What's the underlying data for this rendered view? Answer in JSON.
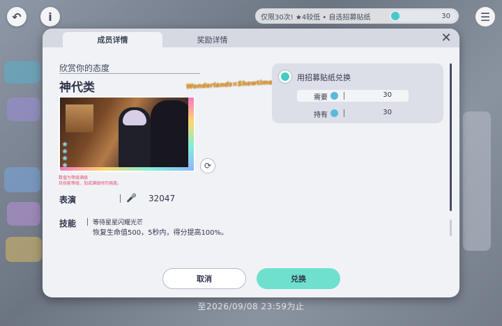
{
  "top": {
    "banner_text": "仅限30次! ★4较低 • 自选招募贴纸",
    "banner_count": "30"
  },
  "tabs": [
    {
      "label": "成员详情"
    },
    {
      "label": "奖励详情"
    }
  ],
  "member": {
    "subtitle": "欣赏你的态度",
    "name": "神代类",
    "unit_logo": "Wonderlands×Showtime",
    "note_line1": "数值为等级满级",
    "note_line2": "且技能等级、加成满级时的强度。"
  },
  "performance": {
    "label": "表演",
    "value": "32047"
  },
  "skill": {
    "label": "技能",
    "name": "等待星星闪耀光芒",
    "description": "恢复生命值500，5秒内，得分提高100%。"
  },
  "exchange": {
    "label": "用招募贴纸兑换",
    "need_label": "需要",
    "need_value": "30",
    "have_label": "持有",
    "have_value": "30"
  },
  "buttons": {
    "cancel": "取消",
    "confirm": "兑换"
  },
  "footer": {
    "deadline": "至2026/09/08 23:59为止"
  },
  "colors": {
    "accent": "#6fe0ce",
    "modal": "#f1f2f6"
  }
}
